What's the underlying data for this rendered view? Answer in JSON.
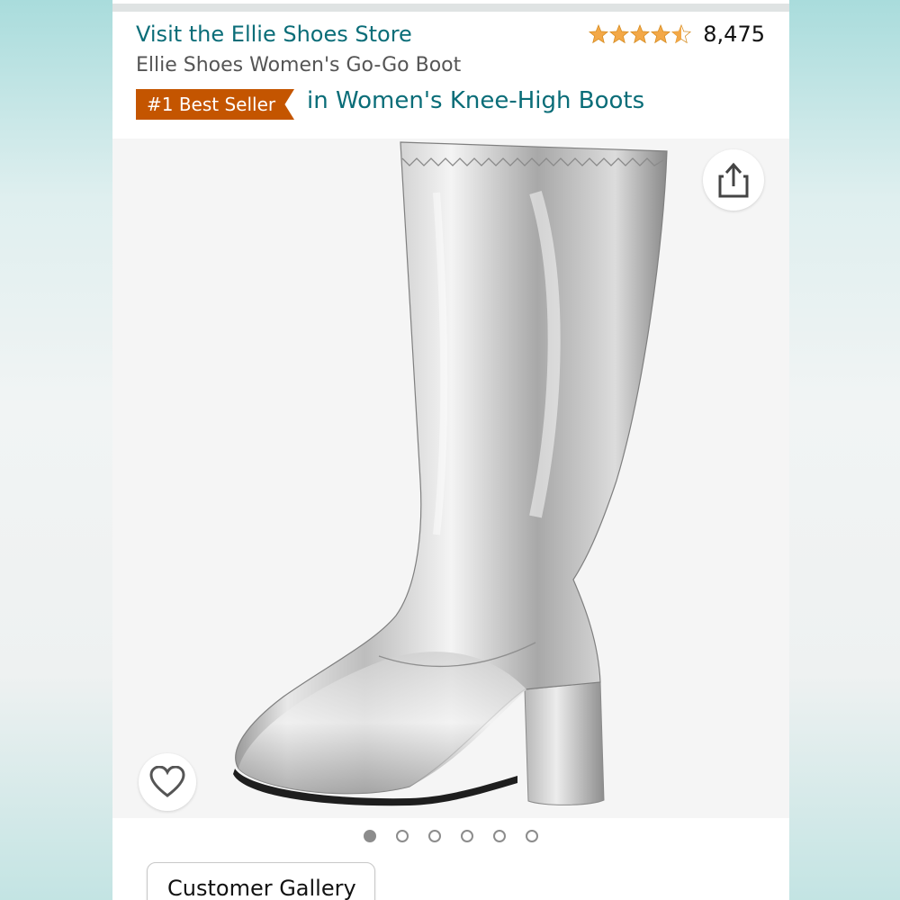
{
  "header": {
    "store_link": "Visit the Ellie Shoes Store",
    "rating": {
      "stars": 4.5,
      "count": "8,475",
      "star_color": "#f3a847"
    },
    "product_title": "Ellie Shoes Women's Go-Go Boot",
    "badge": {
      "label": "#1 Best Seller",
      "category": "in Women's Knee-High Boots",
      "color": "#c45500"
    }
  },
  "image": {
    "subject_icon": "silver-knee-high-boot",
    "share_icon": "share-icon",
    "wishlist_icon": "heart-icon"
  },
  "carousel": {
    "total": 6,
    "active": 1
  },
  "gallery_button": {
    "label": "Customer Gallery"
  },
  "colors": {
    "link": "#0a6d78",
    "badge": "#c45500",
    "text": "#111111"
  }
}
